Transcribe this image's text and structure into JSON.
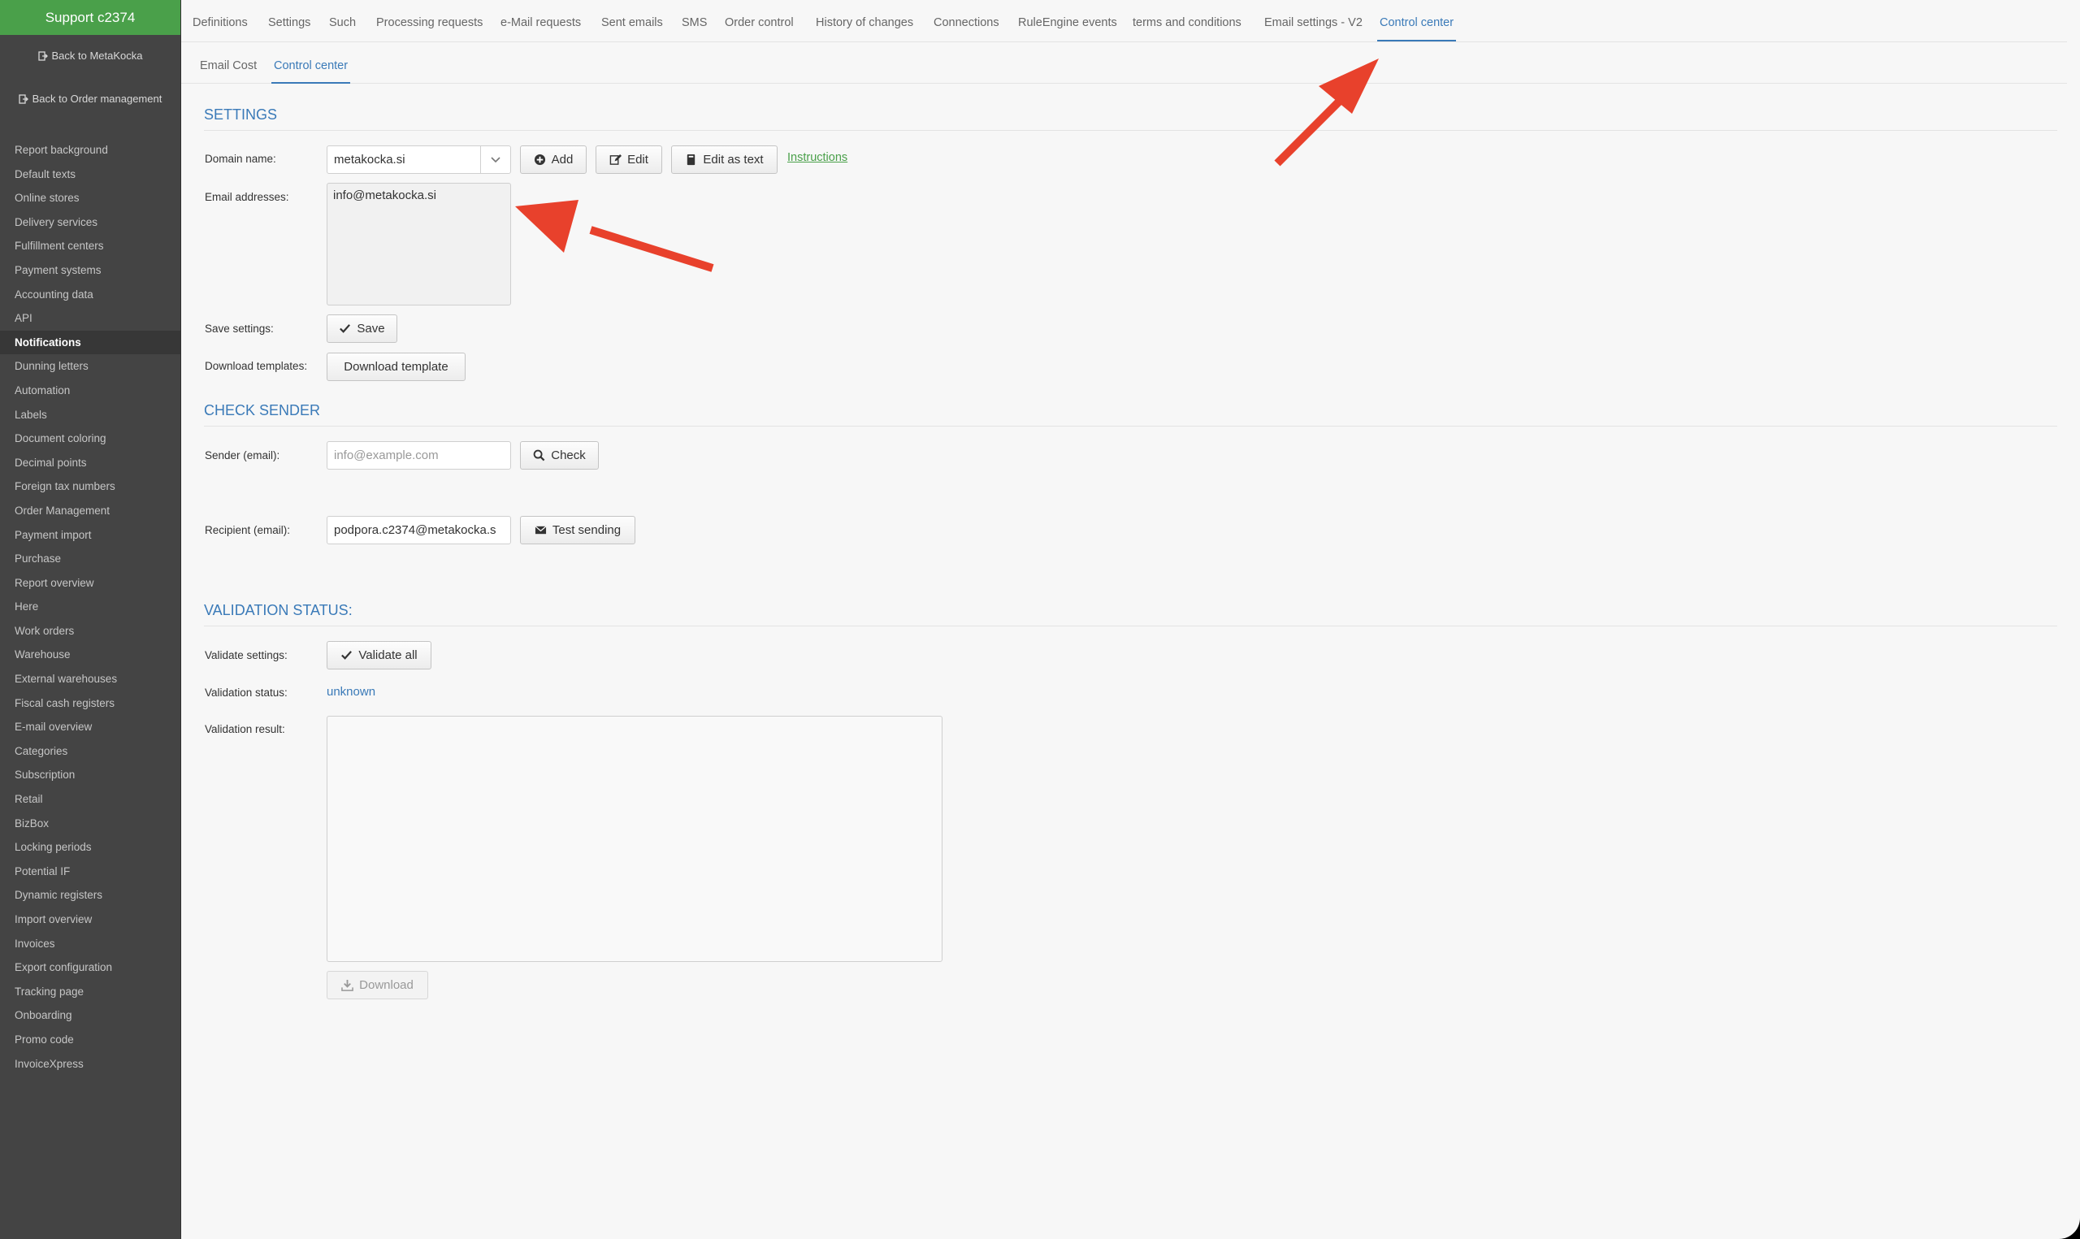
{
  "sidebar": {
    "brand": "Support c2374",
    "back_metakocka": "Back to MetaKocka",
    "back_orders": "Back to Order management",
    "items": [
      {
        "label": "Report background"
      },
      {
        "label": "Default texts"
      },
      {
        "label": "Online stores"
      },
      {
        "label": "Delivery services"
      },
      {
        "label": "Fulfillment centers"
      },
      {
        "label": "Payment systems"
      },
      {
        "label": "Accounting data"
      },
      {
        "label": "API"
      },
      {
        "label": "Notifications",
        "active": true
      },
      {
        "label": "Dunning letters"
      },
      {
        "label": "Automation"
      },
      {
        "label": "Labels"
      },
      {
        "label": "Document coloring"
      },
      {
        "label": "Decimal points"
      },
      {
        "label": "Foreign tax numbers"
      },
      {
        "label": "Order Management"
      },
      {
        "label": "Payment import"
      },
      {
        "label": "Purchase"
      },
      {
        "label": "Report overview"
      },
      {
        "label": "Here"
      },
      {
        "label": "Work orders"
      },
      {
        "label": "Warehouse"
      },
      {
        "label": "External warehouses"
      },
      {
        "label": "Fiscal cash registers"
      },
      {
        "label": "E-mail overview"
      },
      {
        "label": "Categories"
      },
      {
        "label": "Subscription"
      },
      {
        "label": "Retail"
      },
      {
        "label": "BizBox"
      },
      {
        "label": "Locking periods"
      },
      {
        "label": "Potential IF"
      },
      {
        "label": "Dynamic registers"
      },
      {
        "label": "Import overview"
      },
      {
        "label": "Invoices"
      },
      {
        "label": "Export configuration"
      },
      {
        "label": "Tracking page"
      },
      {
        "label": "Onboarding"
      },
      {
        "label": "Promo code"
      },
      {
        "label": "InvoiceXpress"
      }
    ]
  },
  "tabs": [
    {
      "label": "Definitions"
    },
    {
      "label": "Settings"
    },
    {
      "label": "Such"
    },
    {
      "label": "Processing requests"
    },
    {
      "label": "e-Mail requests"
    },
    {
      "label": "Sent emails"
    },
    {
      "label": "SMS"
    },
    {
      "label": "Order control"
    },
    {
      "label": "History of changes"
    },
    {
      "label": "Connections"
    },
    {
      "label": "RuleEngine events"
    },
    {
      "label": "terms and conditions"
    },
    {
      "label": "Email settings - V2"
    },
    {
      "label": "Control center",
      "active": true
    }
  ],
  "subtabs": [
    {
      "label": "Email Cost"
    },
    {
      "label": "Control center",
      "active": true
    }
  ],
  "settings": {
    "title": "SETTINGS",
    "domain_label": "Domain name:",
    "domain_value": "metakocka.si",
    "add": "Add",
    "edit": "Edit",
    "edit_text": "Edit as text",
    "instructions": "Instructions",
    "emails_label": "Email addresses:",
    "emails_value": "info@metakocka.si",
    "save_label": "Save settings:",
    "save": "Save",
    "download_label": "Download templates:",
    "download_template": "Download template"
  },
  "check_sender": {
    "title": "CHECK SENDER",
    "sender_label": "Sender (email):",
    "sender_placeholder": "info@example.com",
    "check": "Check",
    "recipient_label": "Recipient (email):",
    "recipient_value": "podpora.c2374@metakocka.s",
    "test": "Test sending"
  },
  "validation": {
    "title": "VALIDATION STATUS:",
    "validate_label": "Validate settings:",
    "validate_all": "Validate all",
    "status_label": "Validation status:",
    "status_value": "unknown",
    "result_label": "Validation result:",
    "result_value": "",
    "download": "Download"
  },
  "colors": {
    "brand": "#4aa04a",
    "accent": "#3a7ab8",
    "annotation_arrow": "#e8412c"
  }
}
